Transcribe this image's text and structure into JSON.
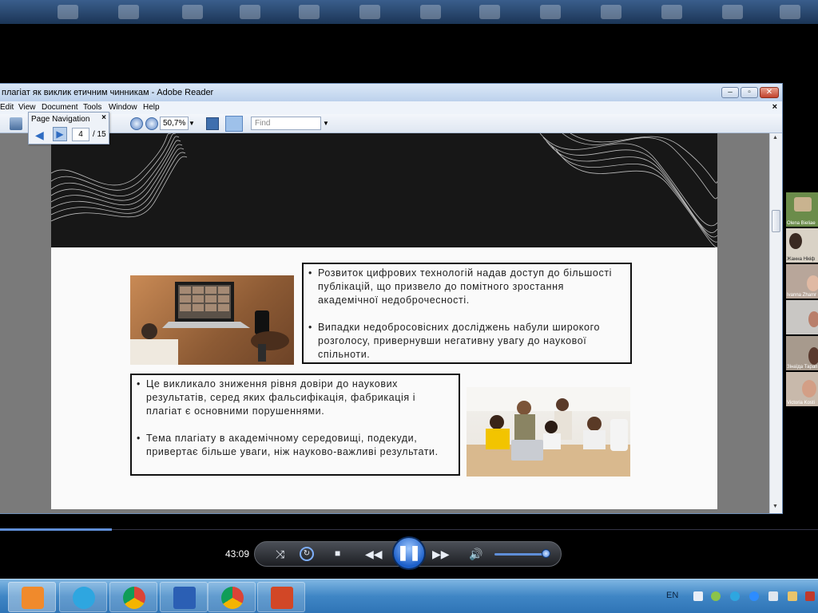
{
  "reader": {
    "title": "плагіат як виклик етичним чинникам - Adobe Reader",
    "menu": [
      "Edit",
      "View",
      "Document",
      "Tools",
      "Window",
      "Help"
    ],
    "zoom": "50,7%",
    "find_placeholder": "Find",
    "window_buttons": {
      "minimize": "–",
      "maximize": "▫",
      "close": "✕"
    },
    "doc_close": "×"
  },
  "page_navigation": {
    "title": "Page Navigation",
    "close": "×",
    "current_page": "4",
    "total": "/ 15"
  },
  "slide": {
    "box1": [
      "Розвиток цифрових технологій надав доступ до більшості публікацій, що призвело до помітного зростання академічної недоброчесності.",
      "Випадки недобросовісних досліджень набули широкого розголосу, привернувши негативну увагу до наукової спільноти."
    ],
    "box2": [
      "Це викликало зниження рівня довіри до наукових результатів, серед яких фальсифікація, фабрикація і плагіат є основними порушеннями.",
      "Тема плагіату в академічному середовищі, подекуди, привертає більше уваги, ніж науково-важливі результати."
    ]
  },
  "participants": [
    {
      "name": "Olena Bieliae"
    },
    {
      "name": "Жанна Нікіф"
    },
    {
      "name": "Ivanna Zhamr"
    },
    {
      "name": ""
    },
    {
      "name": "Зінаїда Тарап"
    },
    {
      "name": "Victoria Kosti"
    }
  ],
  "player": {
    "time": "43:09",
    "progress": 0.137,
    "volume": 0.95
  },
  "taskbar": {
    "language": "EN",
    "apps": [
      "media-player",
      "telegram",
      "chrome",
      "word",
      "chrome-profile",
      "powerpoint"
    ]
  },
  "colors": {
    "slide_header": "#171717",
    "accent_blue": "#2f6cc2"
  }
}
